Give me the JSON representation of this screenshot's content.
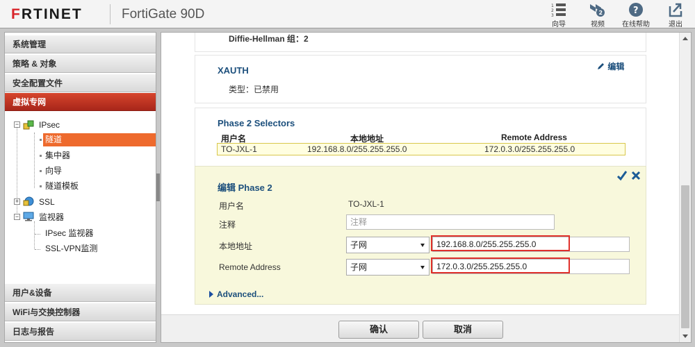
{
  "header": {
    "brand_accent": "F",
    "brand_rest": "RTINET",
    "device": "FortiGate 90D",
    "buttons": [
      {
        "icon": "wizard-icon",
        "label": "向导"
      },
      {
        "icon": "video-icon",
        "label": "视频"
      },
      {
        "icon": "help-icon",
        "label": "在线帮助"
      },
      {
        "icon": "logout-icon",
        "label": "退出"
      }
    ]
  },
  "sidebar": {
    "top_menus": [
      "系统管理",
      "策略 & 对象",
      "安全配置文件"
    ],
    "active_menu": "虚拟专网",
    "tree": {
      "ipsec": "IPsec",
      "ipsec_children": [
        "隧道",
        "集中器",
        "向导",
        "隧道模板"
      ],
      "ssl": "SSL",
      "monitor": "监视器",
      "monitor_children": [
        "IPsec 监视器",
        "SSL-VPN监测"
      ]
    },
    "bottom_menus": [
      "用户&设备",
      "WiFi与交换控制器",
      "日志与报告"
    ]
  },
  "content": {
    "dh_group": "Diffie-Hellman 组：2",
    "xauth": {
      "title": "XAUTH",
      "edit": "编辑",
      "type": "类型：已禁用"
    },
    "phase2_selectors": {
      "title": "Phase 2 Selectors",
      "columns": [
        "用户名",
        "本地地址",
        "Remote Address"
      ],
      "rows": [
        [
          "TO-JXL-1",
          "192.168.8.0/255.255.255.0",
          "172.0.3.0/255.255.255.0"
        ]
      ]
    },
    "edit_phase2": {
      "title": "编辑 Phase 2",
      "name_label": "用户名",
      "name_value": "TO-JXL-1",
      "comment_label": "注释",
      "comment_placeholder": "注释",
      "local_label": "本地地址",
      "local_type": "子网",
      "local_value": "192.168.8.0/255.255.255.0",
      "remote_label": "Remote Address",
      "remote_type": "子网",
      "remote_value": "172.0.3.0/255.255.255.0",
      "advanced": "Advanced..."
    },
    "footer": {
      "ok": "确认",
      "cancel": "取消"
    }
  },
  "colors": {
    "brand_red": "#d8242a",
    "active_menu": "#b8301f",
    "selected_tree": "#ee6a2d",
    "title_blue": "#1c4f7c",
    "highlight_box": "#e0312b"
  }
}
